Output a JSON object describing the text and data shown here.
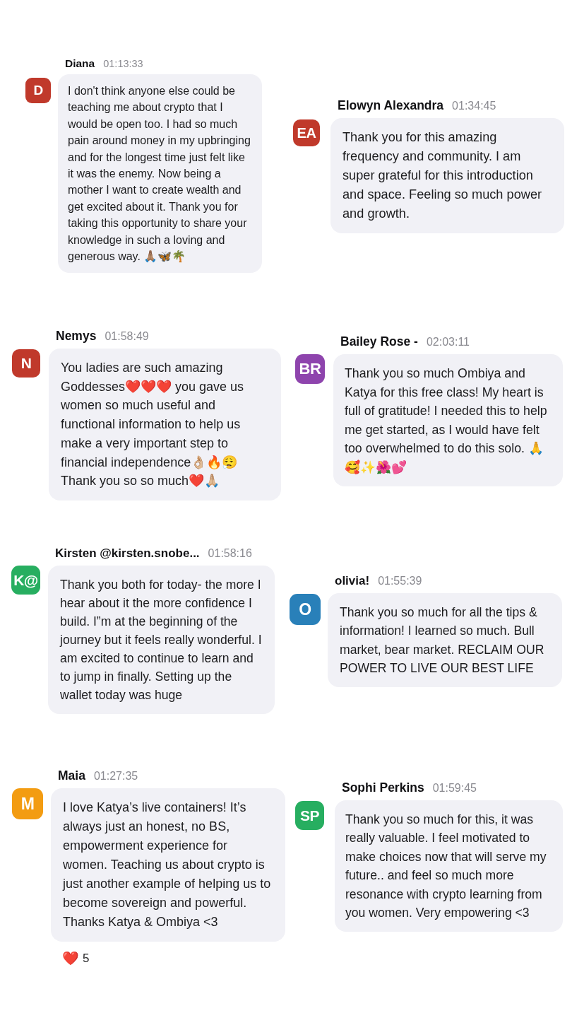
{
  "messages": [
    {
      "author": "Diana",
      "time": "01:13:33",
      "avatar": {
        "initials": "D",
        "color": "#c0392b"
      },
      "text": "I don't think anyone else could be teaching me about crypto that I would be open too. I had so much pain around money in my upbringing and for the longest time just felt like it was the enemy. Now being a mother I want to create wealth and get excited about it. Thank you for taking this opportunity to share your knowledge in such a loving and generous way. 🙏🏽🦋🌴"
    },
    {
      "author": "Elowyn Alexandra",
      "time": "01:34:45",
      "avatar": {
        "initials": "EA",
        "color": "#c0392b"
      },
      "text": "Thank you for this amazing frequency and community. I am super grateful for this introduction and space. Feeling so much power and growth."
    },
    {
      "author": "Nemys",
      "time": "01:58:49",
      "avatar": {
        "initials": "N",
        "color": "#c0392b"
      },
      "text": "You ladies are such amazing Goddesses❤️❤️❤️ you gave us women so much useful and functional information to help us make a very important step to financial independence👌🏼🔥😮‍💨 Thank you so so much❤️🙏🏼"
    },
    {
      "author": "Bailey Rose -",
      "time": "02:03:11",
      "avatar": {
        "initials": "BR",
        "color": "#8e44ad"
      },
      "text": "Thank you so much Ombiya and Katya for this free class! My heart is full of gratitude! I needed this to help me get started, as I would have felt too overwhelmed to do this solo. 🙏 🥰✨🌺💕"
    },
    {
      "author": "Kirsten @kirsten.snobe...",
      "time": "01:58:16",
      "avatar": {
        "initials": "K@",
        "color": "#27ae60"
      },
      "text": "Thank you both for today- the more I hear about it the more confidence I build. I”m at the beginning of the journey but it feels really wonderful. I am excited to continue to learn and to jump in finally. Setting up the wallet today was huge"
    },
    {
      "author": "olivia!",
      "time": "01:55:39",
      "avatar": {
        "initials": "O",
        "color": "#2980b9"
      },
      "text": "Thank you so much for all the tips & information! I learned so much. Bull market, bear market. RECLAIM OUR POWER TO LIVE OUR BEST LIFE"
    },
    {
      "author": "Maia",
      "time": "01:27:35",
      "avatar": {
        "initials": "M",
        "color": "#f39c12"
      },
      "text": "I love Katya’s live containers! It’s always just an honest, no BS, empowerment experience for women. Teaching us about crypto is just another example of helping us to become sovereign and powerful. Thanks Katya & Ombiya <3",
      "reactions": [
        {
          "emoji": "❤️",
          "count": "5"
        }
      ]
    },
    {
      "author": "Sophi Perkins",
      "time": "01:59:45",
      "avatar": {
        "initials": "SP",
        "color": "#27ae60"
      },
      "text": "Thank you so much for this, it was really valuable. I feel motivated to make choices now that will serve my future.. and feel so much more resonance with crypto learning from you women. Very empowering <3"
    }
  ]
}
